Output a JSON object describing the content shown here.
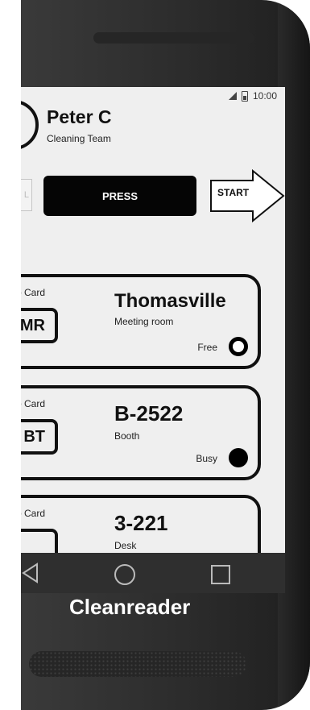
{
  "status_bar": {
    "time": "10:00"
  },
  "profile": {
    "name": "Peter C",
    "role": "Cleaning Team"
  },
  "actions": {
    "cancel_label": "L",
    "press_label": "PRESS",
    "start_label": "START"
  },
  "cards": [
    {
      "sub_label": "b Card",
      "tag": "MR",
      "name": "Thomasville",
      "type": "Meeting room",
      "status": "Free",
      "status_state": "free"
    },
    {
      "sub_label": "b Card",
      "tag": "BT",
      "name": "B-2522",
      "type": "Booth",
      "status": "Busy",
      "status_state": "busy"
    },
    {
      "sub_label": "b Card",
      "tag": "",
      "name": "3-221",
      "type": "Desk",
      "status": "",
      "status_state": ""
    }
  ],
  "device": {
    "caption": "Cleanreader"
  },
  "colors": {
    "screen_bg": "#efefef",
    "ink": "#111111",
    "device_body": "#2b2b2b"
  },
  "icons": [
    "signal-icon",
    "battery-icon",
    "back-icon",
    "home-icon",
    "recent-apps-icon"
  ]
}
